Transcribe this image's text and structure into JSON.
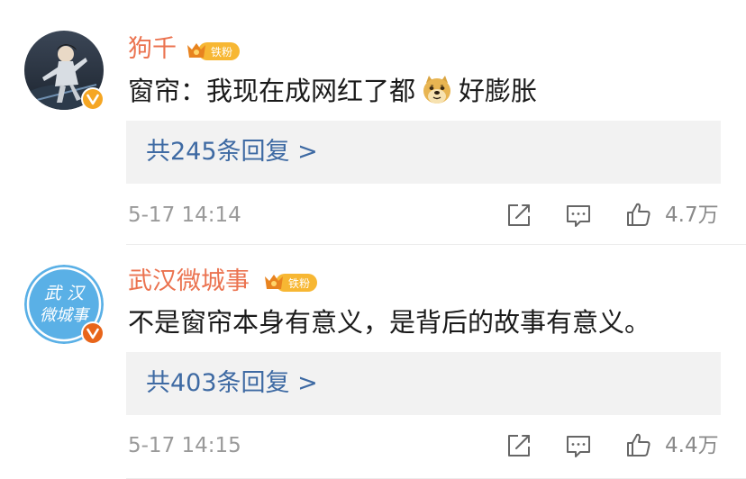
{
  "comments": [
    {
      "username": "狗千",
      "fan_badge_label": "铁粉",
      "content_prefix": "窗帘：我现在成网红了都",
      "content_emoji": "doge-emoji",
      "content_suffix": "好膨胀",
      "reply_link": "共245条回复 >",
      "timestamp": "5-17 14:14",
      "like_count": "4.7万"
    },
    {
      "username": "武汉微城事",
      "fan_badge_label": "铁粉",
      "avatar_text": [
        "武 汉",
        "微城事"
      ],
      "content": "不是窗帘本身有意义，是背后的故事有意义。",
      "reply_link": "共403条回复 >",
      "timestamp": "5-17 14:15",
      "like_count": "4.4万"
    }
  ],
  "colors": {
    "username": "#eb7350",
    "reply_link": "#3e6aa3",
    "reply_bg": "#f2f2f2",
    "meta_text": "#9a9a9a",
    "verified_badge": "#f5a623",
    "avatar2_bg": "#5ab0e6"
  },
  "icons": [
    "share-icon",
    "comment-icon",
    "like-icon",
    "verified-badge-icon",
    "fan-badge-icon"
  ]
}
